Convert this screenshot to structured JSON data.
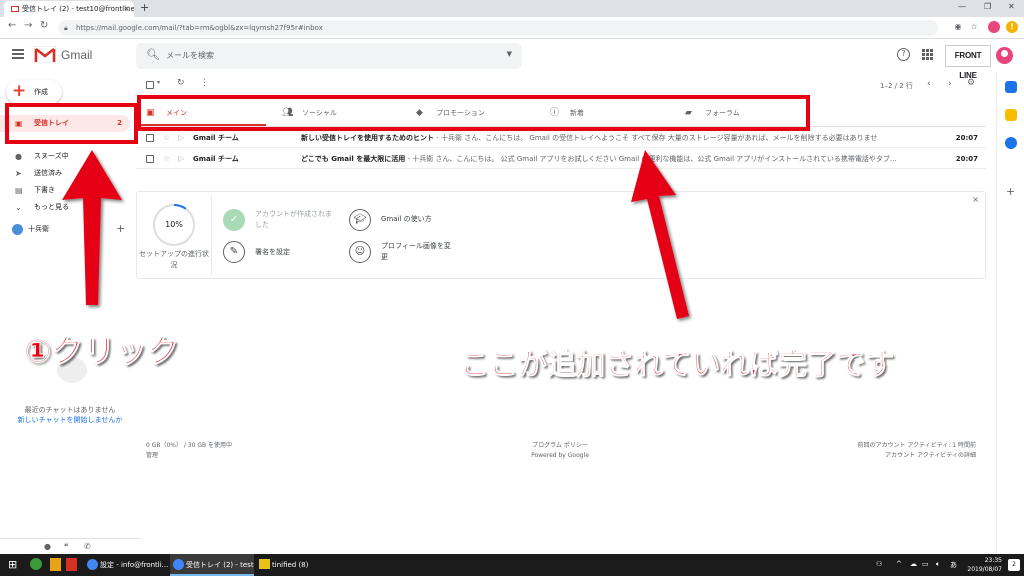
{
  "browser": {
    "tab_title": "受信トレイ (2) - test10@frontline -",
    "tab_close": "×",
    "new_tab": "+",
    "url": "https://mail.google.com/mail/?tab=rm&ogbl&zx=lqymsh27f95r#inbox",
    "window_min": "—",
    "window_max": "❐",
    "window_close": "✕",
    "ext_badge": "!"
  },
  "header": {
    "app_name": "Gmail",
    "search_placeholder": "メールを検索",
    "brand_logo": "FRONT LINE"
  },
  "sidebar": {
    "compose_label": "作成",
    "items": [
      {
        "label": "受信トレイ",
        "count": "2",
        "icon": "inbox-icon"
      },
      {
        "label": "スヌーズ中",
        "icon": "clock-icon"
      },
      {
        "label": "送信済み",
        "icon": "send-icon"
      },
      {
        "label": "下書き",
        "icon": "draft-icon"
      },
      {
        "label": "もっと見る",
        "icon": "chevron-down-icon"
      }
    ],
    "user_name": "十兵衛",
    "chat_empty": "最近のチャットはありません",
    "chat_start": "新しいチャットを開始しませんか"
  },
  "toolbar": {
    "pager": "1–2 / 2 行"
  },
  "categories": [
    {
      "label": "メイン",
      "icon": "inbox-icon",
      "active": true
    },
    {
      "label": "ソーシャル",
      "icon": "people-icon",
      "active": false
    },
    {
      "label": "プロモーション",
      "icon": "tag-icon",
      "active": false
    },
    {
      "label": "新着",
      "icon": "info-icon",
      "active": false
    },
    {
      "label": "フォーラム",
      "icon": "forum-icon",
      "active": false
    }
  ],
  "emails": [
    {
      "from": "Gmail チーム",
      "subject": "新しい受信トレイを使用するためのヒント",
      "snippet": " - 十兵衛 さん、こんにちは。 Gmail の受信トレイへようこそ すべて保存 大量のストレージ容量があれば、メールを削除する必要はありませ",
      "time": "20:07"
    },
    {
      "from": "Gmail チーム",
      "subject": "どこでも Gmail を最大限に活用",
      "snippet": " - 十兵衛 さん、こんにちは。 公式 Gmail アプリをお試しください Gmail の便利な機能は、公式 Gmail アプリがインストールされている携帯電話やタブ...",
      "time": "20:07"
    }
  ],
  "setup": {
    "progress": "10%",
    "progress_fraction": 0.1,
    "label": "セットアップの進行状況",
    "items": [
      {
        "text": "アカウントが作成されました",
        "done": true
      },
      {
        "text": "Gmail の使い方",
        "done": false
      },
      {
        "text": "署名を設定",
        "done": false
      },
      {
        "text": "プロフィール画像を変更",
        "done": false
      }
    ],
    "close": "×"
  },
  "footer": {
    "storage": "0 GB（0%） / 30 GB を使用中",
    "manage": "管理",
    "policy": "プログラム ポリシー",
    "powered": "Powered by Google",
    "activity": "前回のアカウント アクティビティ: 1 時間前",
    "activity_detail": "アカウント アクティビティの詳細"
  },
  "taskbar": {
    "item_settings": "設定 - info@frontli...",
    "item_gmail": "受信トレイ (2) - test1...",
    "item_folder": "tinified (8)",
    "time": "23:35",
    "date": "2019/08/07",
    "ime": "あ",
    "notif_count": "2"
  },
  "annotations": {
    "click_label": "①クリック",
    "done_label": "ここが追加されていれば完了です"
  },
  "colors": {
    "accent": "#d93025",
    "annotation_red": "#e60012"
  }
}
